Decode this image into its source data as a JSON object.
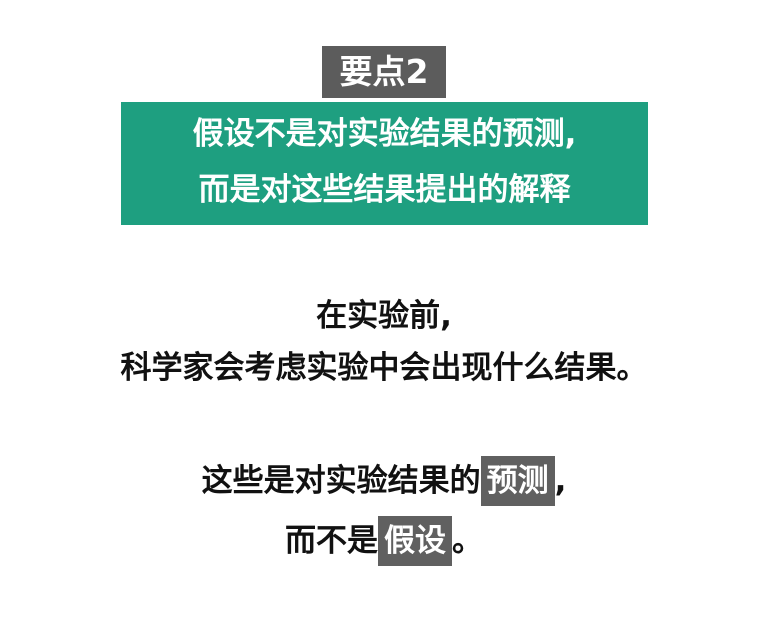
{
  "badge": "要点2",
  "highlight_box": {
    "line1": "假设不是对实验结果的预测,",
    "line2": "而是对这些结果提出的解释"
  },
  "paragraph1": {
    "line1": "在实验前,",
    "line2": "科学家会考虑实验中会出现什么结果。"
  },
  "paragraph2": {
    "line1_prefix": "这些是对实验结果的",
    "line1_highlight": "预测",
    "line1_suffix": ",",
    "line2_prefix": "而不是",
    "line2_highlight": "假设",
    "line2_suffix": "。"
  },
  "colors": {
    "badge_bg": "#5c5c5c",
    "box_bg": "#1e9f80",
    "highlight_bg": "#606060",
    "text": "#111111",
    "background": "#ffffff"
  }
}
